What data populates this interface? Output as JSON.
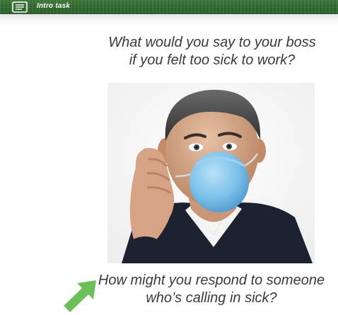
{
  "header": {
    "tab_label": "Intro task",
    "tab_icon": "notes-icon"
  },
  "main": {
    "question_line1": "What would you say to your boss",
    "question_line2": "if you felt too sick to work?",
    "photo_icon": "man-with-mask-on-phone-photo",
    "prompt_line1": "How might you respond to someone",
    "prompt_line2": "who’s calling in sick?",
    "arrow_icon": "green-arrow-icon"
  },
  "colors": {
    "header_green": "#2f6a2e",
    "text": "#3a3a3a",
    "arrow_green": "#6bbf59"
  }
}
